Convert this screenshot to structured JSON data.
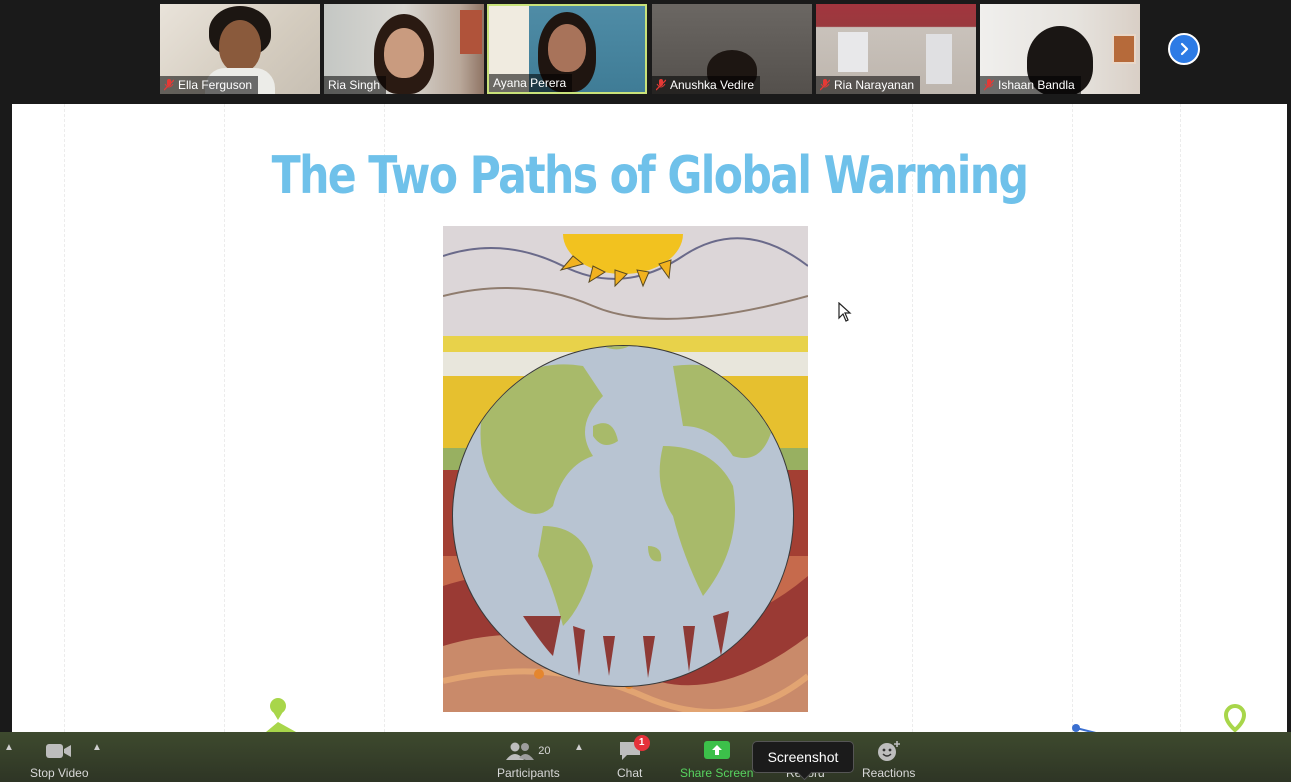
{
  "participants": [
    {
      "name": "Ella Ferguson",
      "muted": true
    },
    {
      "name": "Ria Singh",
      "muted": false
    },
    {
      "name": "Ayana Perera",
      "muted": false,
      "active": true
    },
    {
      "name": "Anushka Vedire",
      "muted": true
    },
    {
      "name": "Ria Narayanan",
      "muted": true
    },
    {
      "name": "Ishaan Bandla",
      "muted": true
    }
  ],
  "slide": {
    "title": "The Two Paths of Global Warming"
  },
  "toolbar": {
    "stop_video": "Stop Video",
    "participants_label": "Participants",
    "participants_count": "20",
    "chat": "Chat",
    "chat_badge": "1",
    "share_screen": "Share Screen",
    "record": "Record",
    "reactions": "Reactions"
  },
  "tooltip": "Screenshot",
  "colors": {
    "title": "#6fc1ea",
    "active_border": "#c9e27a",
    "share_green": "#3cc04a",
    "next_blue": "#2d7be5",
    "badge_red": "#e5323a"
  },
  "icons": [
    "microphone-muted-icon",
    "chevron-right-icon",
    "video-camera-icon",
    "people-icon",
    "chat-bubble-icon",
    "share-screen-icon",
    "reactions-icon",
    "mouse-cursor-icon"
  ]
}
